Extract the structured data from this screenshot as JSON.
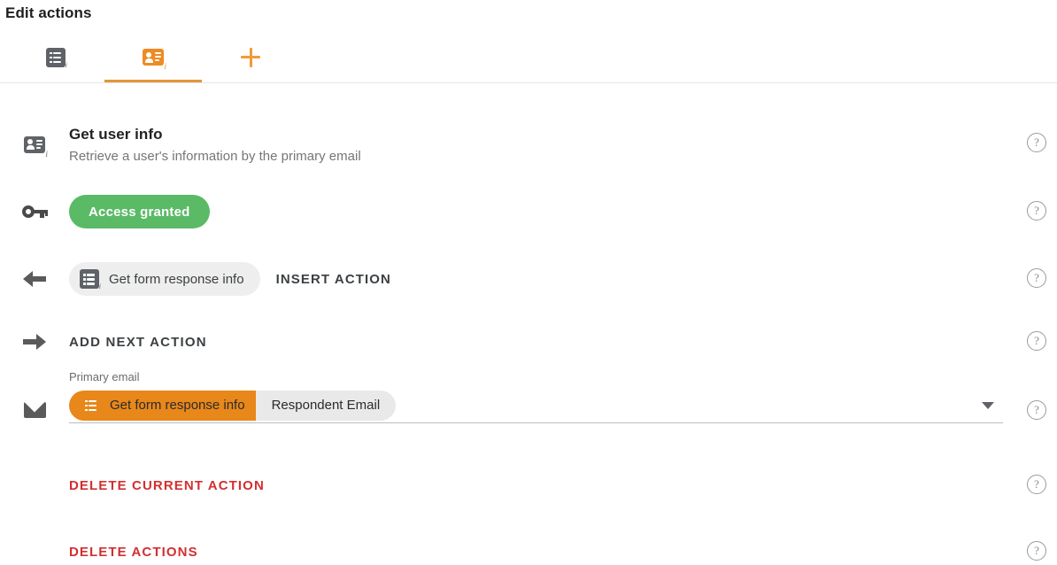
{
  "header": {
    "title": "Edit actions"
  },
  "tabs": [
    {
      "icon": "form-icon",
      "active": false,
      "name": "tab-form-action"
    },
    {
      "icon": "contact-card-icon",
      "active": true,
      "name": "tab-user-action"
    },
    {
      "icon": "plus-icon",
      "active": false,
      "name": "tab-add-action"
    }
  ],
  "rows": {
    "action_info": {
      "icon": "contact-card-icon",
      "title": "Get user info",
      "subtitle": "Retrieve a user's information by the primary email",
      "help": "?"
    },
    "access": {
      "icon": "key-icon",
      "badge_label": "Access granted",
      "badge_color": "#5aba66",
      "help": "?"
    },
    "insert": {
      "icon": "arrow-left-icon",
      "chip_label": "Get form response info",
      "chip_icon": "form-icon",
      "action_label": "INSERT ACTION",
      "help": "?"
    },
    "add_next": {
      "icon": "arrow-right-icon",
      "action_label": "ADD NEXT ACTION",
      "help": "?"
    },
    "primary_email": {
      "icon": "envelope-icon",
      "field_label": "Primary email",
      "token_source": "Get form response info",
      "token_source_icon": "form-icon",
      "token_value": "Respondent Email",
      "token_source_color": "#e8871a",
      "token_value_color": "#e9e9e9",
      "dropdown_icon": "chevron-down-icon",
      "help": "?"
    },
    "delete_current": {
      "label": "DELETE CURRENT ACTION",
      "color": "#d32f2f",
      "help": "?"
    },
    "delete_all": {
      "label": "DELETE ACTIONS",
      "color": "#d32f2f",
      "help": "?"
    }
  }
}
